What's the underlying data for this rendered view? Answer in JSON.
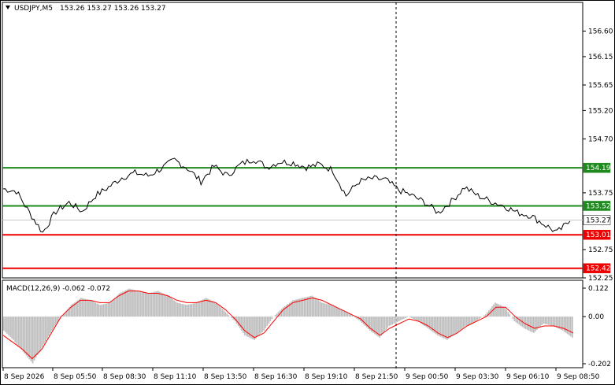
{
  "window": {
    "symbol_header": "USDJPY,M5",
    "ohlc": "153.26 153.27 153.26 153.27",
    "menu_arrow_icon": "triangle-down-icon"
  },
  "colors": {
    "price_line": "#000000",
    "green_level": "#1e8a1e",
    "red_level": "#ee0000",
    "current_price_tag": "#ffffff",
    "macd_hist": "#bebebe",
    "macd_signal": "#ff0000",
    "grid_separator": "#000000"
  },
  "chart_data": [
    {
      "type": "line",
      "title": "USDJPY,M5",
      "x": [
        "8 Sep 2026",
        "",
        "8 Sep 05:50",
        "",
        "8 Sep 08:30",
        "",
        "8 Sep 11:10",
        "",
        "8 Sep 13:50",
        "",
        "8 Sep 16:30",
        "",
        "8 Sep 19:10",
        "",
        "8 Sep 21:50",
        "",
        "9 Sep 00:50",
        "",
        "9 Sep 03:30",
        "",
        "9 Sep 06:10",
        "",
        "9 Sep 08:50"
      ],
      "x_tick_labels": [
        "8 Sep 2026",
        "8 Sep 05:50",
        "8 Sep 08:30",
        "8 Sep 11:10",
        "8 Sep 13:50",
        "8 Sep 16:30",
        "8 Sep 19:10",
        "8 Sep 21:50",
        "9 Sep 00:50",
        "9 Sep 03:30",
        "9 Sep 06:10",
        "9 Sep 08:50"
      ],
      "series": [
        {
          "values": [
            153.82,
            153.78,
            153.4,
            153.05,
            153.42,
            153.58,
            153.42,
            153.7,
            153.85,
            154.02,
            154.1,
            154.05,
            154.18,
            154.33,
            154.18,
            153.95,
            154.22,
            154.05,
            154.25,
            154.35,
            154.2,
            154.3,
            154.28,
            154.2,
            154.25,
            154.15,
            153.7,
            153.95,
            154.0,
            153.98,
            153.8,
            153.7,
            153.58,
            153.4,
            153.6,
            153.85,
            153.7,
            153.6,
            153.52,
            153.4,
            153.35,
            153.2,
            153.05,
            153.25
          ]
        }
      ],
      "price_axis_ticks": [
        "156.60",
        "156.15",
        "155.65",
        "155.20",
        "154.70",
        "153.75",
        "152.75",
        "152.25"
      ],
      "ylim": [
        152.25,
        156.85
      ],
      "levels": [
        {
          "value": 154.19,
          "label": "154.19",
          "color": "green"
        },
        {
          "value": 153.52,
          "label": "153.52",
          "color": "green"
        },
        {
          "value": 153.27,
          "label": "153.27",
          "color": "current"
        },
        {
          "value": 153.01,
          "label": "153.01",
          "color": "red"
        },
        {
          "value": 152.42,
          "label": "152.42",
          "color": "red"
        }
      ],
      "vertical_marker": "9 Sep 00:50"
    },
    {
      "type": "bar",
      "title": "MACD(12,26,9) -0.062 -0.072",
      "indicator": "MACD(12,26,9)",
      "macd_value": -0.062,
      "signal_value": -0.072,
      "y_ticks": [
        "0.122",
        "0.00",
        "-0.202"
      ],
      "ylim": [
        -0.202,
        0.122
      ],
      "histogram": [
        -0.06,
        -0.1,
        -0.15,
        -0.2,
        -0.13,
        -0.06,
        0.0,
        0.05,
        0.08,
        0.07,
        0.05,
        0.06,
        0.1,
        0.12,
        0.11,
        0.1,
        0.11,
        0.09,
        0.06,
        0.05,
        0.06,
        0.08,
        0.06,
        0.02,
        -0.02,
        -0.08,
        -0.1,
        -0.06,
        0.0,
        0.04,
        0.07,
        0.08,
        0.09,
        0.06,
        0.05,
        0.03,
        0.01,
        -0.02,
        -0.06,
        -0.09,
        -0.04,
        -0.02,
        0.0,
        -0.02,
        -0.05,
        -0.08,
        -0.1,
        -0.07,
        -0.04,
        -0.02,
        0.01,
        0.06,
        0.04,
        -0.02,
        -0.05,
        -0.07,
        -0.03,
        -0.04,
        -0.06,
        -0.09
      ],
      "signal": [
        -0.08,
        -0.11,
        -0.14,
        -0.18,
        -0.14,
        -0.07,
        0.0,
        0.04,
        0.07,
        0.07,
        0.06,
        0.06,
        0.09,
        0.11,
        0.11,
        0.1,
        0.1,
        0.09,
        0.07,
        0.06,
        0.06,
        0.07,
        0.06,
        0.03,
        -0.01,
        -0.06,
        -0.09,
        -0.07,
        -0.02,
        0.03,
        0.06,
        0.07,
        0.08,
        0.07,
        0.05,
        0.03,
        0.01,
        -0.01,
        -0.05,
        -0.08,
        -0.05,
        -0.03,
        -0.01,
        -0.02,
        -0.04,
        -0.07,
        -0.09,
        -0.07,
        -0.04,
        -0.02,
        0.0,
        0.04,
        0.04,
        0.0,
        -0.03,
        -0.05,
        -0.04,
        -0.04,
        -0.05,
        -0.07
      ]
    }
  ]
}
